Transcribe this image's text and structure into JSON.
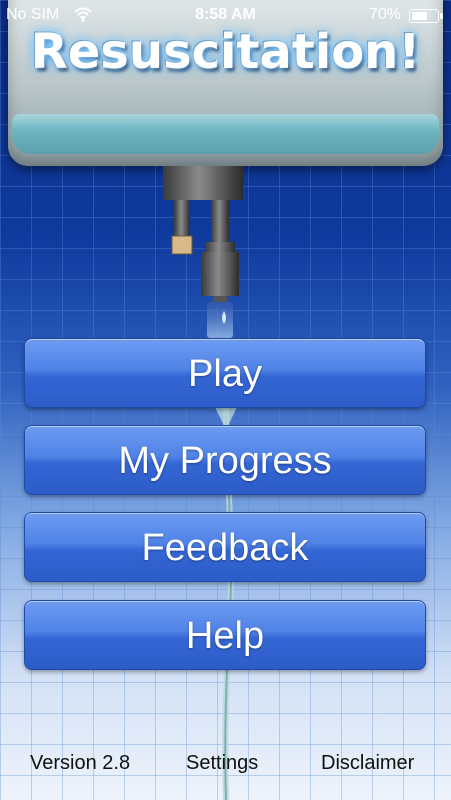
{
  "status_bar": {
    "carrier": "No SIM",
    "time": "8:58 AM",
    "battery_percent": "70%",
    "battery_level": 0.7,
    "wifi_icon": "wifi-icon",
    "battery_icon": "battery-icon"
  },
  "header": {
    "title": "Resuscitation!"
  },
  "menu": {
    "play_label": "Play",
    "progress_label": "My Progress",
    "feedback_label": "Feedback",
    "help_label": "Help"
  },
  "footer": {
    "version": "Version 2.8",
    "settings": "Settings",
    "disclaimer": "Disclaimer"
  },
  "colors": {
    "button": "#3f73dc",
    "background_top": "#0b2a86",
    "background_bottom": "#eef3fb",
    "water": "#6fb6c2"
  }
}
